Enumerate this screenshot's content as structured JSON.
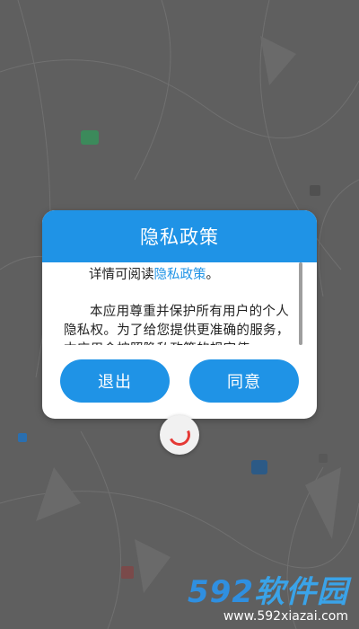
{
  "dialog": {
    "title": "隐私政策",
    "intro_prefix": "详情可阅读",
    "intro_link": "隐私政策",
    "intro_suffix": "。",
    "paragraph": "本应用尊重并保护所有用户的个人隐私权。为了给您提供更准确的服务，本应用会按照隐私政策的规定使",
    "exit_label": "退出",
    "agree_label": "同意"
  },
  "watermark": {
    "logo_number": "592",
    "logo_text": "软件园",
    "url": "www.592xiazai.com"
  },
  "colors": {
    "accent": "#1f93e6",
    "overlay": "#5f5f5f",
    "spinner": "#e53935"
  }
}
